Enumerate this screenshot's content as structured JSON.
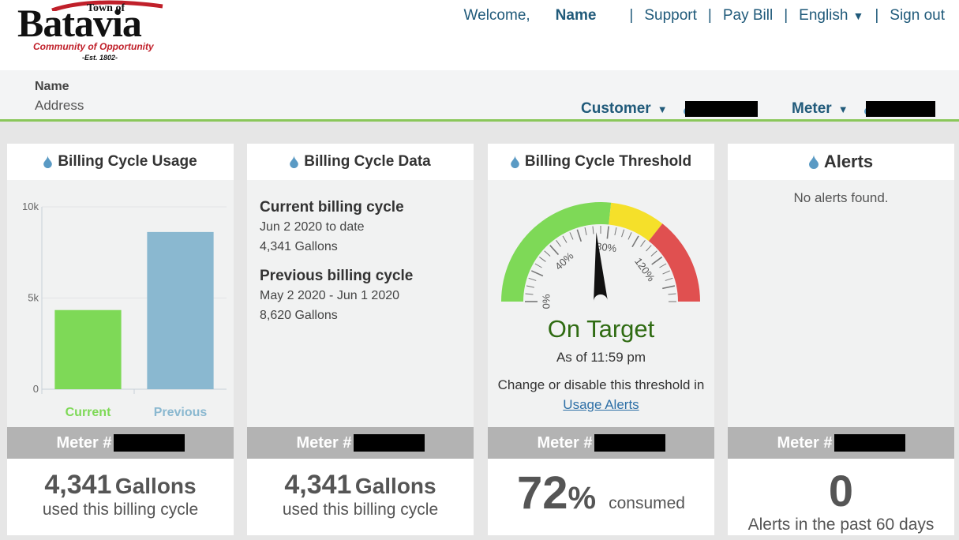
{
  "brand": {
    "town_of": "Town of",
    "name": "Batavia",
    "tagline": "Community of Opportunity",
    "established": "-Est. 1802-"
  },
  "topnav": {
    "welcome": "Welcome,",
    "user_name": "Name",
    "support": "Support",
    "pay_bill": "Pay Bill",
    "language": "English",
    "sign_out": "Sign out"
  },
  "account": {
    "name": "Name",
    "address": "Address",
    "customer_label": "Customer",
    "meter_label": "Meter"
  },
  "usage_card": {
    "title": "Billing Cycle Usage",
    "meter_label": "Meter #",
    "amount": "4,341",
    "unit": "Gallons",
    "subtitle": "used this billing cycle"
  },
  "chart_data": {
    "type": "bar",
    "categories": [
      "Current",
      "Previous"
    ],
    "values": [
      4341,
      8620
    ],
    "colors": [
      "#7ed957",
      "#8ab8d0"
    ],
    "ylim": [
      0,
      10000
    ],
    "yticks": [
      0,
      5000,
      10000
    ],
    "ytick_labels": [
      "0",
      "5k",
      "10k"
    ],
    "grid": true
  },
  "data_card": {
    "title": "Billing Cycle Data",
    "current_heading": "Current billing cycle",
    "current_period": "Jun 2 2020 to date",
    "current_amount": "4,341 Gallons",
    "previous_heading": "Previous billing cycle",
    "previous_period": "May 2 2020 - Jun 1 2020",
    "previous_amount": "8,620 Gallons",
    "meter_label": "Meter #",
    "amount": "4,341",
    "unit": "Gallons",
    "subtitle": "used this billing cycle"
  },
  "threshold_card": {
    "title": "Billing Cycle Threshold",
    "gauge": {
      "value_percent": 72,
      "max_percent": 150,
      "tick_labels": [
        "0%",
        "40%",
        "80%",
        "120%"
      ],
      "zone_colors": [
        "#7ed957",
        "#f5e02a",
        "#e05050"
      ]
    },
    "status": "On Target",
    "as_of": "As of 11:59 pm",
    "change_text": "Change or disable this threshold in",
    "link_text": "Usage Alerts",
    "meter_label": "Meter #",
    "percent": "72",
    "percent_sign": "%",
    "consumed": "consumed"
  },
  "alerts_card": {
    "title": "Alerts",
    "empty_text": "No alerts found.",
    "meter_label": "Meter #",
    "count": "0",
    "subtitle": "Alerts in the past 60 days"
  },
  "colors": {
    "accent_green": "#8ac75a",
    "nav_blue": "#205a7a",
    "drop_blue": "#5a9ac4",
    "status_green": "#2f6b12"
  }
}
